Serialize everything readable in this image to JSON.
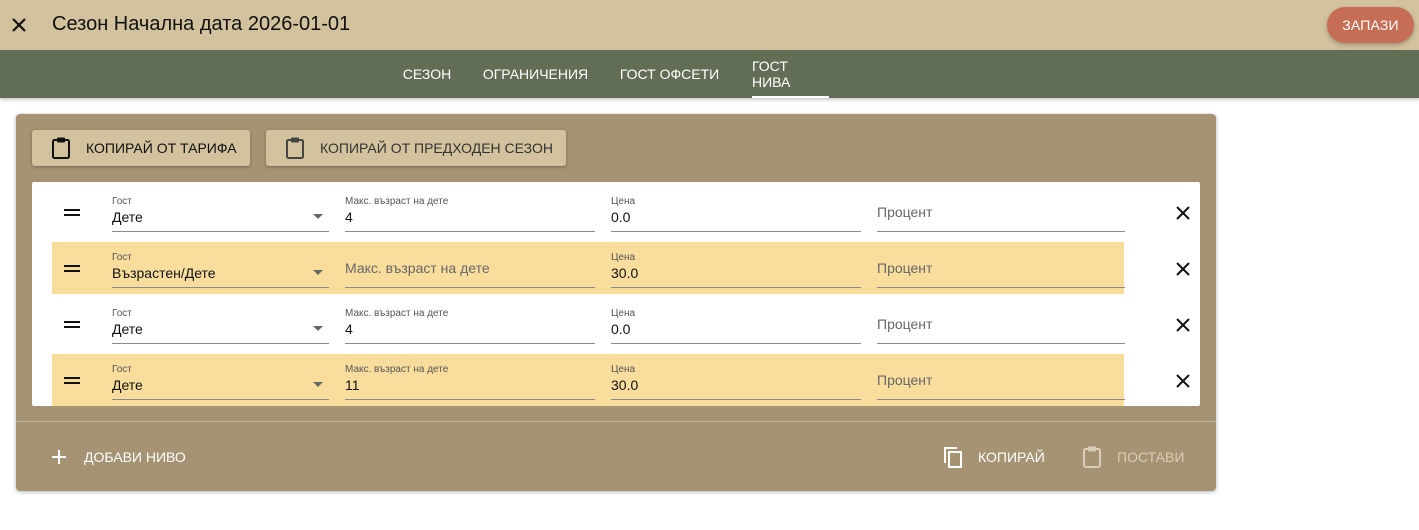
{
  "header": {
    "title": "Сезон Начална дата 2026-01-01",
    "save_label": "ЗАПАЗИ"
  },
  "tabs": [
    {
      "label": "СЕЗОН",
      "active": false
    },
    {
      "label": "ОГРАНИЧЕНИЯ",
      "active": false
    },
    {
      "label": "ГОСТ ОФСЕТИ",
      "active": false
    },
    {
      "label": "ГОСТ НИВА",
      "active": true
    }
  ],
  "toolbar": {
    "copy_from_rate": "КОПИРАЙ ОТ ТАРИФА",
    "copy_from_prev_season": "КОПИРАЙ ОТ ПРЕДХОДЕН СЕЗОН"
  },
  "field_labels": {
    "guest": "Гост",
    "max_child_age": "Макс. възраст на дете",
    "price": "Цена",
    "percent": "Процент"
  },
  "rows": [
    {
      "guest": "Дете",
      "max_child_age": "4",
      "price": "0.0",
      "percent": "",
      "highlighted": false
    },
    {
      "guest": "Възрастен/Дете",
      "max_child_age": "",
      "price": "30.0",
      "percent": "",
      "highlighted": true
    },
    {
      "guest": "Дете",
      "max_child_age": "4",
      "price": "0.0",
      "percent": "",
      "highlighted": false
    },
    {
      "guest": "Дете",
      "max_child_age": "11",
      "price": "30.0",
      "percent": "",
      "highlighted": true
    }
  ],
  "footer": {
    "add_level": "ДОБАВИ НИВО",
    "copy": "КОПИРАЙ",
    "paste": "ПОСТАВИ"
  },
  "colors": {
    "topbar": "#d2c29e",
    "tabbar": "#626d56",
    "panel": "#a69373",
    "highlight_row": "#f9dd9d",
    "save_button": "#c66e55"
  }
}
